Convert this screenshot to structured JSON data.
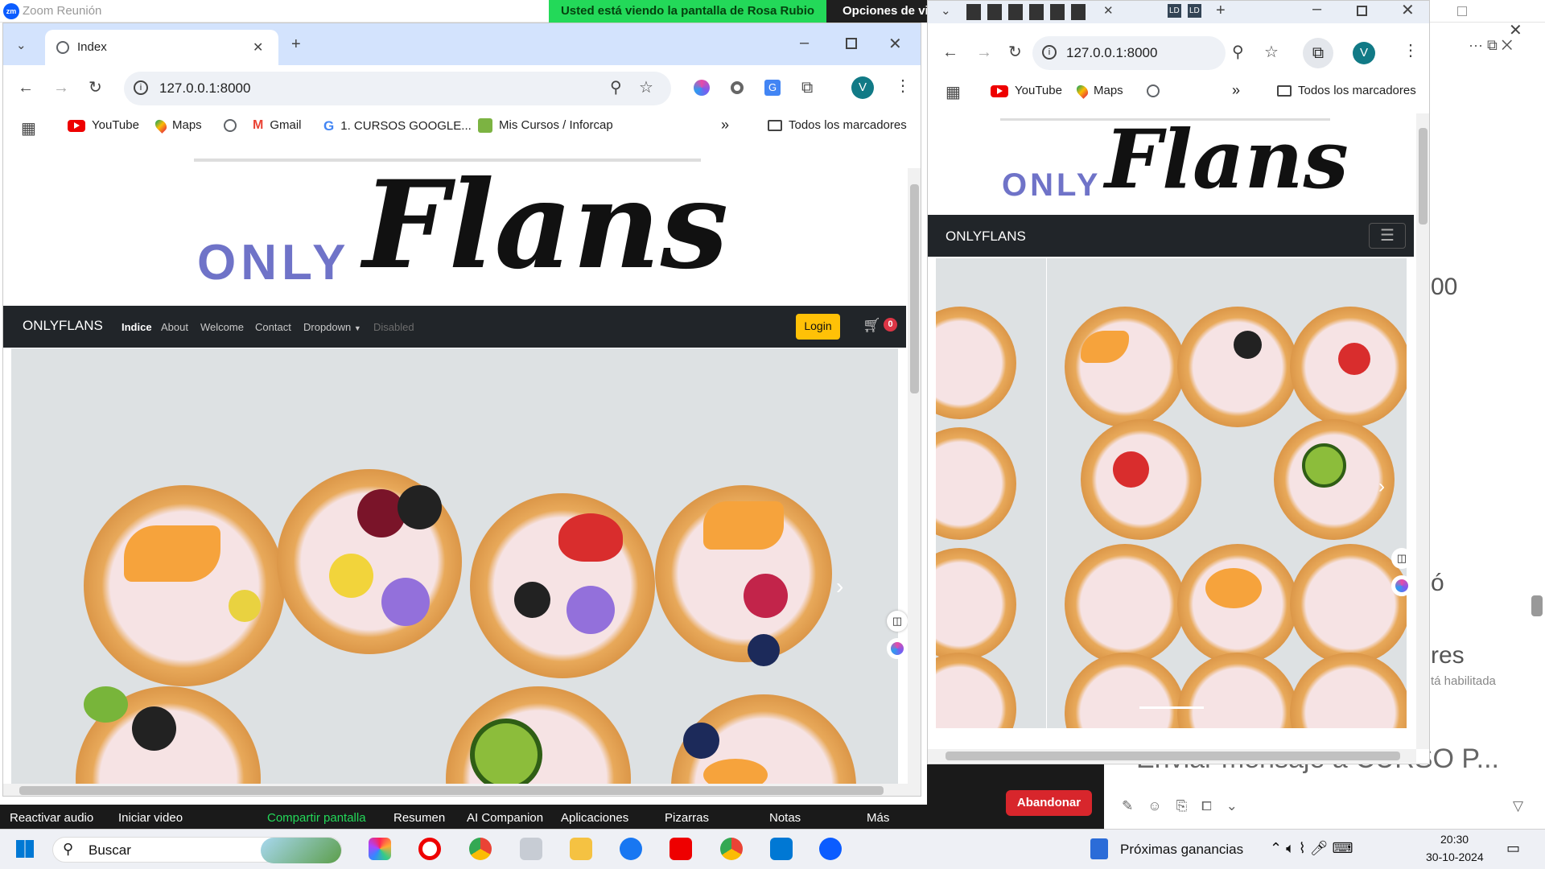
{
  "zoom": {
    "app_title": "Zoom Reunión",
    "logo": "zm",
    "share_banner": "Usted está viendo la pantalla de Rosa Rubio",
    "view_options": "Opciones de vis",
    "right_fragments": [
      "00",
      "ó",
      "res",
      "tá habilitada",
      "Enviar mensaje a CURSO P..."
    ],
    "leave": "Abandonar",
    "controls": [
      "Reactivar audio",
      "Iniciar video",
      "Compartir pantalla",
      "Resumen",
      "AI Companion",
      "Aplicaciones",
      "Pizarras",
      "Notas",
      "Más"
    ],
    "accent": "#23d959"
  },
  "left_browser": {
    "tab_title": "Index",
    "url": "127.0.0.1:8000",
    "avatar_letter": "V",
    "bookmarks": [
      "YouTube",
      "Maps",
      "Gmail",
      "1. CURSOS GOOGLE...",
      "Mis Cursos / Inforcap",
      "Todos los marcadores"
    ]
  },
  "right_browser": {
    "url": "127.0.0.1:8000",
    "avatar_letter": "V",
    "bookmarks": [
      "YouTube",
      "Maps",
      "Todos los marcadores"
    ],
    "tab_labels": [
      "LD",
      "LD"
    ]
  },
  "site": {
    "logo_only": "ONLY",
    "logo_flans": "Flans",
    "brand": "ONLYFLANS",
    "nav": [
      "Indice",
      "About",
      "Welcome",
      "Contact",
      "Dropdown",
      "Disabled"
    ],
    "login": "Login",
    "cart_count": "0"
  },
  "taskbar": {
    "search": "Buscar",
    "widget": "Próximas ganancias",
    "time": "20:30",
    "date": "30-10-2024"
  }
}
